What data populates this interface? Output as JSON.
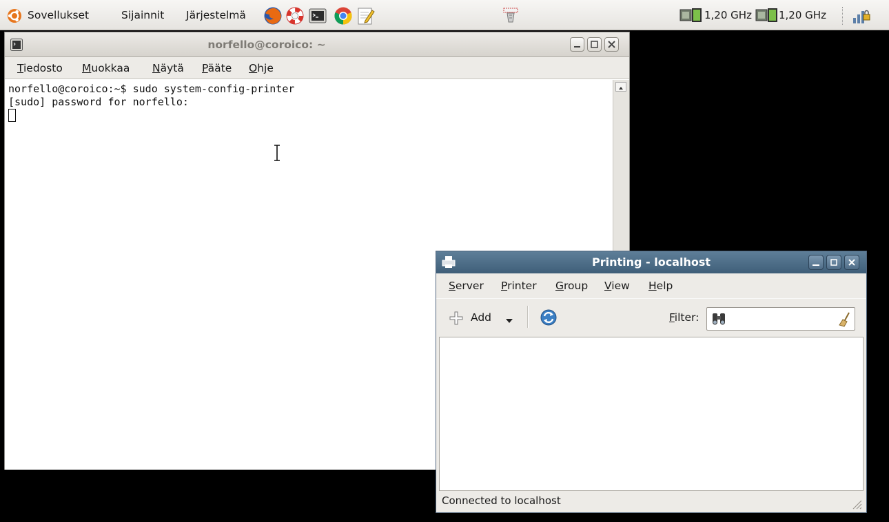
{
  "panel": {
    "menus": [
      "Sovellukset",
      "Sijainnit",
      "Järjestelmä"
    ],
    "launchers": [
      "firefox-icon",
      "help-lifebuoy-icon",
      "terminal-icon",
      "chrome-icon",
      "text-editor-icon"
    ],
    "cpu": [
      {
        "label": "1,20 GHz"
      },
      {
        "label": "1,20 GHz"
      }
    ]
  },
  "terminal": {
    "title": "norfello@coroico: ~",
    "menu": [
      "Tiedosto",
      "Muokkaa",
      "Näytä",
      "Pääte",
      "Ohje"
    ],
    "lines": [
      "norfello@coroico:~$ sudo system-config-printer",
      "[sudo] password for norfello:"
    ]
  },
  "printing": {
    "title": "Printing - localhost",
    "menu": [
      "Server",
      "Printer",
      "Group",
      "View",
      "Help"
    ],
    "toolbar": {
      "add_label": "Add",
      "filter_label": "Filter:",
      "filter_value": ""
    },
    "status": "Connected to localhost"
  }
}
